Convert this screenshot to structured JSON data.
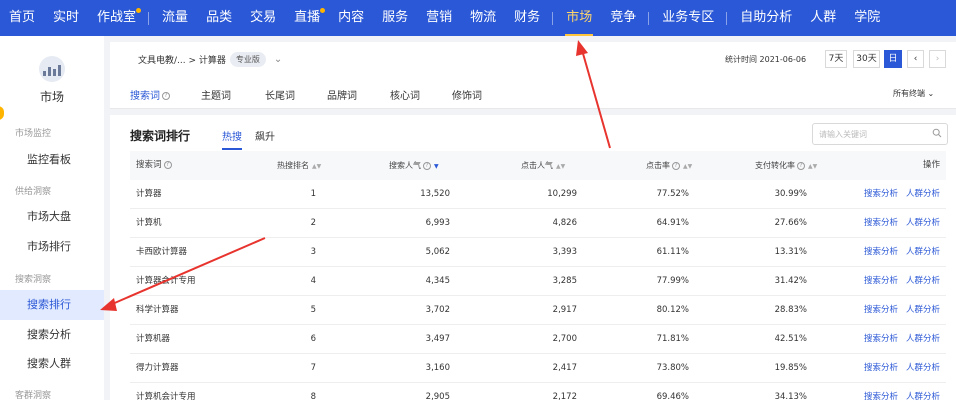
{
  "topnav": {
    "items": [
      {
        "label": "首页"
      },
      {
        "label": "实时"
      },
      {
        "label": "作战室",
        "dot": true
      },
      {
        "label": "流量"
      },
      {
        "label": "品类"
      },
      {
        "label": "交易"
      },
      {
        "label": "直播",
        "dot": true
      },
      {
        "label": "内容"
      },
      {
        "label": "服务"
      },
      {
        "label": "营销"
      },
      {
        "label": "物流"
      },
      {
        "label": "财务"
      },
      {
        "label": "市场",
        "active": true
      },
      {
        "label": "竞争"
      },
      {
        "label": "业务专区"
      },
      {
        "label": "自助分析"
      },
      {
        "label": "人群"
      },
      {
        "label": "学院"
      }
    ]
  },
  "sidebar": {
    "title": "市场",
    "groups": [
      {
        "label": "市场监控"
      },
      {
        "label": "供给洞察"
      },
      {
        "label": "搜索洞察"
      },
      {
        "label": "客群洞察"
      }
    ],
    "items": [
      {
        "label": "监控看板"
      },
      {
        "label": "市场大盘"
      },
      {
        "label": "市场排行"
      },
      {
        "label": "搜索排行",
        "active": true
      },
      {
        "label": "搜索分析"
      },
      {
        "label": "搜索人群"
      }
    ]
  },
  "breadcrumb": {
    "path": "文具电教/... > 计算器",
    "badge": "专业版"
  },
  "stat_time": "统计时间 2021-06-06",
  "date_buttons": [
    "7天",
    "30天",
    "日"
  ],
  "subtabs": [
    "搜索词",
    "主题词",
    "长尾词",
    "品牌词",
    "核心词",
    "修饰词"
  ],
  "terminal": "所有终端",
  "section": {
    "title": "搜索词排行",
    "tabs": [
      "热搜",
      "飙升"
    ],
    "search_placeholder": "请输入关键词"
  },
  "table": {
    "headers": {
      "keyword": "搜索词",
      "rank": "热搜排名",
      "popularity": "搜索人气",
      "clicks": "点击人气",
      "ctr": "点击率",
      "cvr": "支付转化率",
      "ops": "操作"
    },
    "op_labels": [
      "搜索分析",
      "人群分析"
    ],
    "rows": [
      {
        "keyword": "计算器",
        "rank": "1",
        "popularity": "13,520",
        "clicks": "10,299",
        "ctr": "77.52%",
        "cvr": "30.99%"
      },
      {
        "keyword": "计算机",
        "rank": "2",
        "popularity": "6,993",
        "clicks": "4,826",
        "ctr": "64.91%",
        "cvr": "27.66%"
      },
      {
        "keyword": "卡西欧计算器",
        "rank": "3",
        "popularity": "5,062",
        "clicks": "3,393",
        "ctr": "61.11%",
        "cvr": "13.31%"
      },
      {
        "keyword": "计算器会计专用",
        "rank": "4",
        "popularity": "4,345",
        "clicks": "3,285",
        "ctr": "77.99%",
        "cvr": "31.42%"
      },
      {
        "keyword": "科学计算器",
        "rank": "5",
        "popularity": "3,702",
        "clicks": "2,917",
        "ctr": "80.12%",
        "cvr": "28.83%"
      },
      {
        "keyword": "计算机器",
        "rank": "6",
        "popularity": "3,497",
        "clicks": "2,700",
        "ctr": "71.81%",
        "cvr": "42.51%"
      },
      {
        "keyword": "得力计算器",
        "rank": "7",
        "popularity": "3,160",
        "clicks": "2,417",
        "ctr": "73.80%",
        "cvr": "19.85%"
      },
      {
        "keyword": "计算机会计专用",
        "rank": "8",
        "popularity": "2,905",
        "clicks": "2,172",
        "ctr": "69.46%",
        "cvr": "34.13%"
      }
    ]
  },
  "colors": {
    "brand": "#2b58d6",
    "nav_active": "#ffd66b",
    "annotation": "#e8342e"
  }
}
